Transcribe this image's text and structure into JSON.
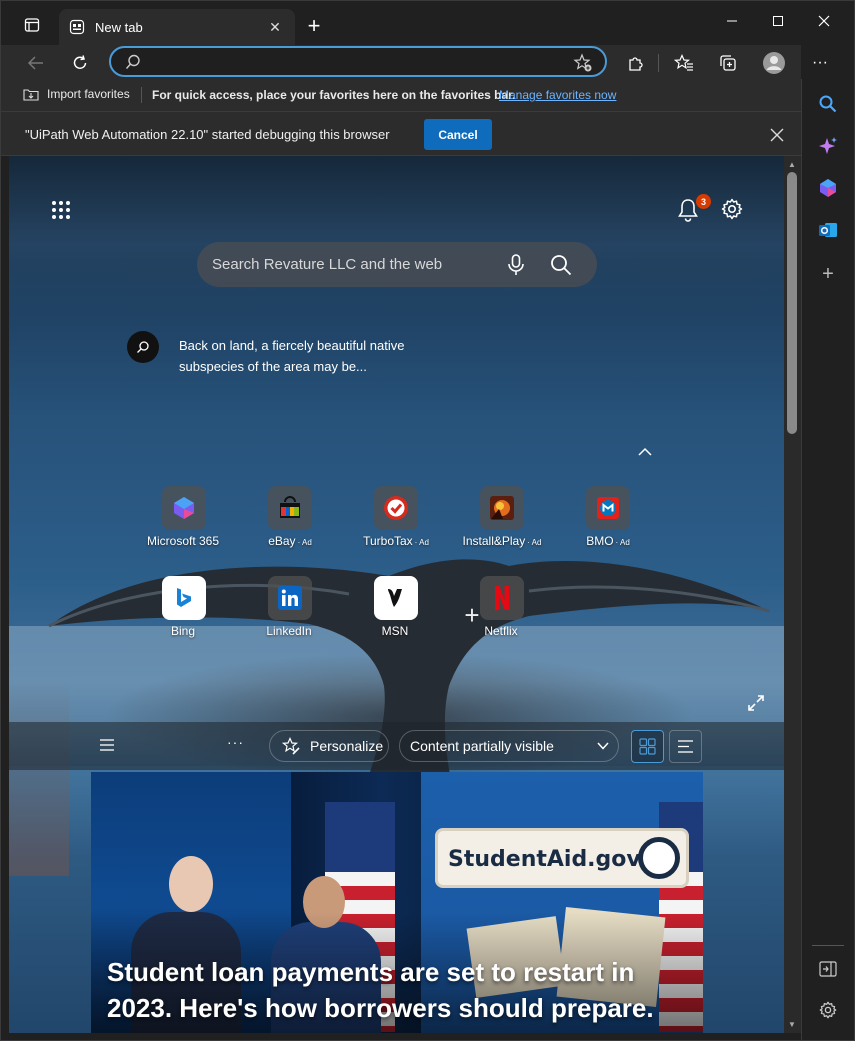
{
  "tabs": [
    {
      "title": "New tab"
    }
  ],
  "address_bar": {
    "value": "",
    "placeholder": ""
  },
  "favorites_bar": {
    "import_label": "Import favorites",
    "hint": "For quick access, place your favorites here on the favorites bar.",
    "manage_link": "Manage favorites now"
  },
  "infobar": {
    "message": "\"UiPath Web Automation 22.10\" started debugging this browser",
    "cancel_label": "Cancel"
  },
  "newtab": {
    "notification_count": "3",
    "search_placeholder": "Search Revature LLC and the web",
    "fact_text": "Back on land, a fiercely beautiful native subspecies of the area may be...",
    "tiles": [
      {
        "label": "Microsoft 365",
        "ad": ""
      },
      {
        "label": "eBay",
        "ad": "· Ad"
      },
      {
        "label": "TurboTax",
        "ad": "· Ad"
      },
      {
        "label": "Install&Play",
        "ad": "· Ad"
      },
      {
        "label": "BMO",
        "ad": "· Ad"
      },
      {
        "label": "Bing",
        "ad": ""
      },
      {
        "label": "LinkedIn",
        "ad": ""
      },
      {
        "label": "MSN",
        "ad": ""
      },
      {
        "label": "Netflix",
        "ad": ""
      }
    ],
    "feed_bar": {
      "more": "···",
      "personalize_label": "Personalize",
      "visibility_value": "Content partially visible"
    },
    "hero": {
      "sign_text": "StudentAid.gov",
      "headline": "Student loan payments are set to restart in 2023. Here's how borrowers should prepare."
    }
  },
  "colors": {
    "accent": "#4a9bd8",
    "cancel_button": "#0f6cbd",
    "badge": "#d83b01",
    "link": "#6cb4ff"
  }
}
